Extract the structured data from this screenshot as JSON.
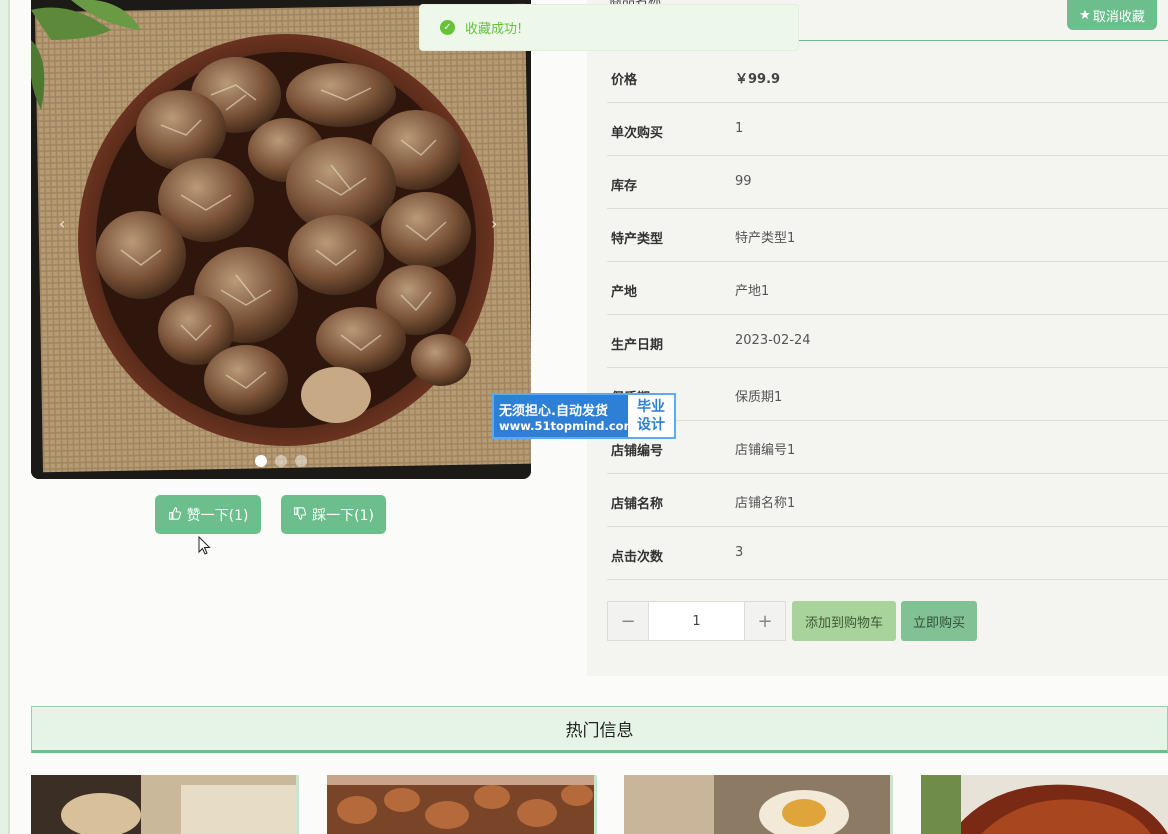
{
  "toast": {
    "message": "收藏成功!",
    "icon": "check-circle-icon"
  },
  "product": {
    "name_fragment": "商品名称",
    "favorite_label": "取消收藏",
    "favorite_icon": "star-icon"
  },
  "details": [
    {
      "key": "价格",
      "value": "￥99.9"
    },
    {
      "key": "单次购买",
      "value": "1"
    },
    {
      "key": "库存",
      "value": "99"
    },
    {
      "key": "特产类型",
      "value": "特产类型1"
    },
    {
      "key": "产地",
      "value": "产地1"
    },
    {
      "key": "生产日期",
      "value": "2023-02-24"
    },
    {
      "key": "保质期",
      "value": "保质期1"
    },
    {
      "key": "店铺编号",
      "value": "店铺编号1"
    },
    {
      "key": "店铺名称",
      "value": "店铺名称1"
    },
    {
      "key": "点击次数",
      "value": "3"
    }
  ],
  "purchase": {
    "minus": "−",
    "quantity": "1",
    "plus": "+",
    "cart_label": "添加到购物车",
    "buy_label": "立即购买"
  },
  "carousel": {
    "prev": "‹",
    "next": "›",
    "slides": 3,
    "active_slide": 1
  },
  "votes": {
    "like_label": "赞一下(1)",
    "dislike_label": "踩一下(1)",
    "like_icon": "thumbs-up-icon",
    "dislike_icon": "thumbs-down-icon"
  },
  "watermark": {
    "line1": "无须担心.自动发货",
    "line2": "www.51topmind.com",
    "badge_line1": "毕业",
    "badge_line2": "设计"
  },
  "hot": {
    "title": "热门信息"
  },
  "colors": {
    "accent": "#6cbf8c",
    "toast_green": "#67c23a",
    "watermark_blue": "#2e7fd6"
  }
}
